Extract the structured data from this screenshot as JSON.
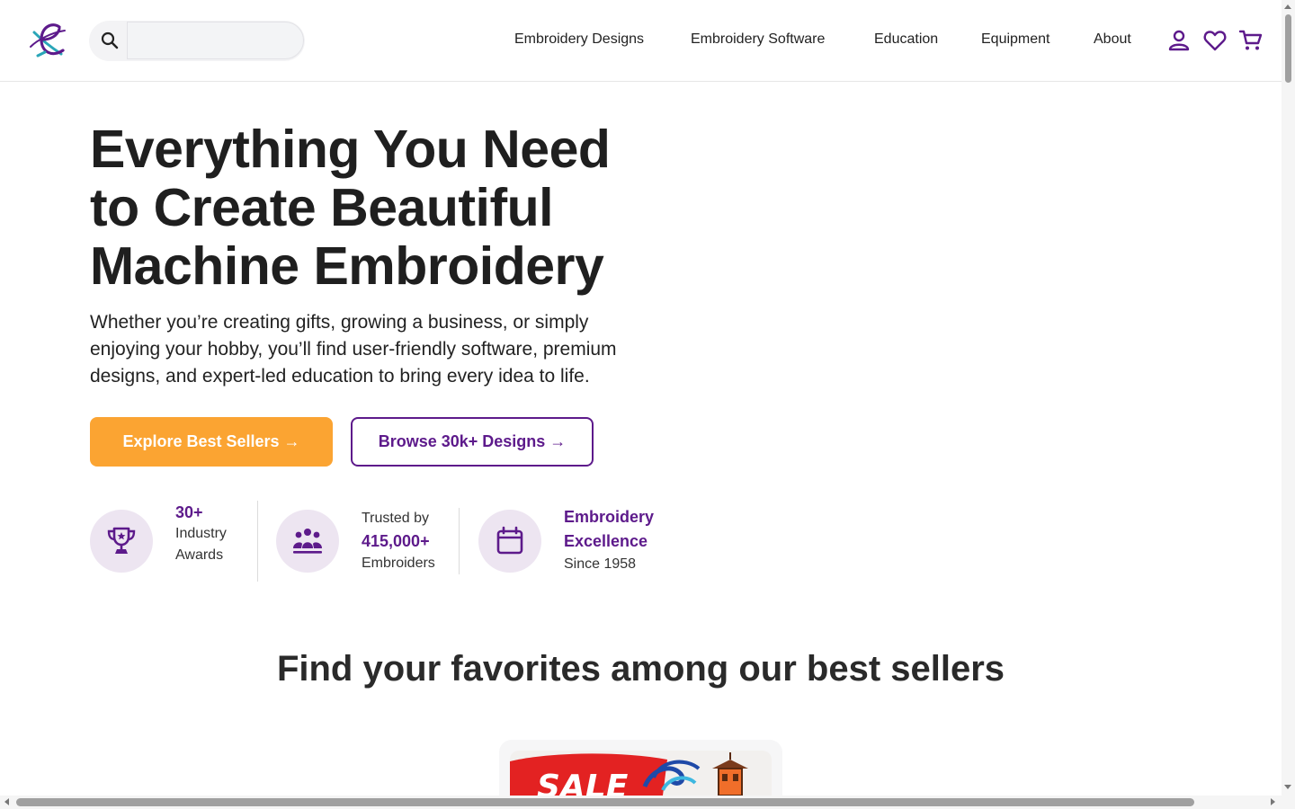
{
  "header": {
    "logo": "e-script-logo",
    "search": {
      "placeholder": "",
      "value": ""
    },
    "nav": [
      {
        "label": "Embroidery Designs"
      },
      {
        "label": "Embroidery Software"
      },
      {
        "label": "Education"
      },
      {
        "label": "Equipment"
      },
      {
        "label": "About"
      }
    ],
    "icons": [
      "account-icon",
      "wishlist-heart-icon",
      "cart-icon"
    ]
  },
  "hero": {
    "title_lines": [
      "Everything You Need",
      "to Create Beautiful",
      "Machine Embroidery"
    ],
    "subtitle_lines": [
      "Whether you’re creating gifts, growing a business, or simply",
      "enjoying your hobby, you’ll find user-friendly software, premium",
      "designs, and expert-led education to bring every idea to life."
    ],
    "primary_button": "Explore Best Sellers →",
    "secondary_button": "Browse 30k+ Designs →"
  },
  "stats": [
    {
      "icon": "trophy-icon",
      "highlight": "30+",
      "line2": "Industry",
      "line3": "Awards"
    },
    {
      "icon": "people-group-icon",
      "line1": "Trusted by",
      "highlight": "415,000+",
      "line3": "Embroiders"
    },
    {
      "icon": "calendar-icon",
      "highlight1": "Embroidery",
      "highlight2": "Excellence",
      "line3": "Since 1958"
    }
  ],
  "best_sellers": {
    "title": "Find your favorites among our best sellers",
    "card_image_text": "SALE"
  },
  "colors": {
    "brand_purple": "#5d1a8b",
    "accent_orange": "#fba432",
    "stat_circle_bg": "#ede5f1"
  }
}
